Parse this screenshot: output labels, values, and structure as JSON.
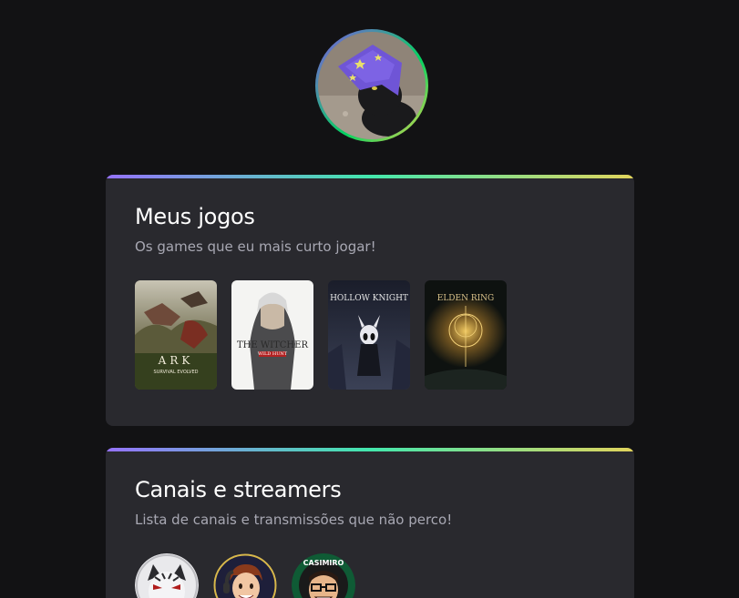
{
  "profile": {
    "avatar_icon": "wizard-cat-avatar"
  },
  "games_section": {
    "title": "Meus jogos",
    "subtitle": "Os games que eu mais curto jogar!",
    "games": [
      {
        "name": "ARK",
        "caption": "SURVIVAL EVOLVED",
        "icon": "ark-cover"
      },
      {
        "name": "THE WITCHER",
        "caption": "WILD HUNT",
        "icon": "witcher-cover"
      },
      {
        "name": "HOLLOW KNIGHT",
        "icon": "hollow-knight-cover"
      },
      {
        "name": "ELDEN RING",
        "icon": "elden-ring-cover"
      }
    ]
  },
  "streamers_section": {
    "title": "Canais e streamers",
    "subtitle": "Lista de canais e transmissões que não perco!",
    "streamers": [
      {
        "icon": "tiger-avatar"
      },
      {
        "icon": "cartoon-guy-avatar"
      },
      {
        "name": "CASIMIRO",
        "icon": "casimiro-avatar"
      }
    ]
  },
  "colors": {
    "background": "#121214",
    "card": "#29292e",
    "gradient": [
      "#9572fc",
      "#43e7ad",
      "#e2d45c"
    ]
  }
}
